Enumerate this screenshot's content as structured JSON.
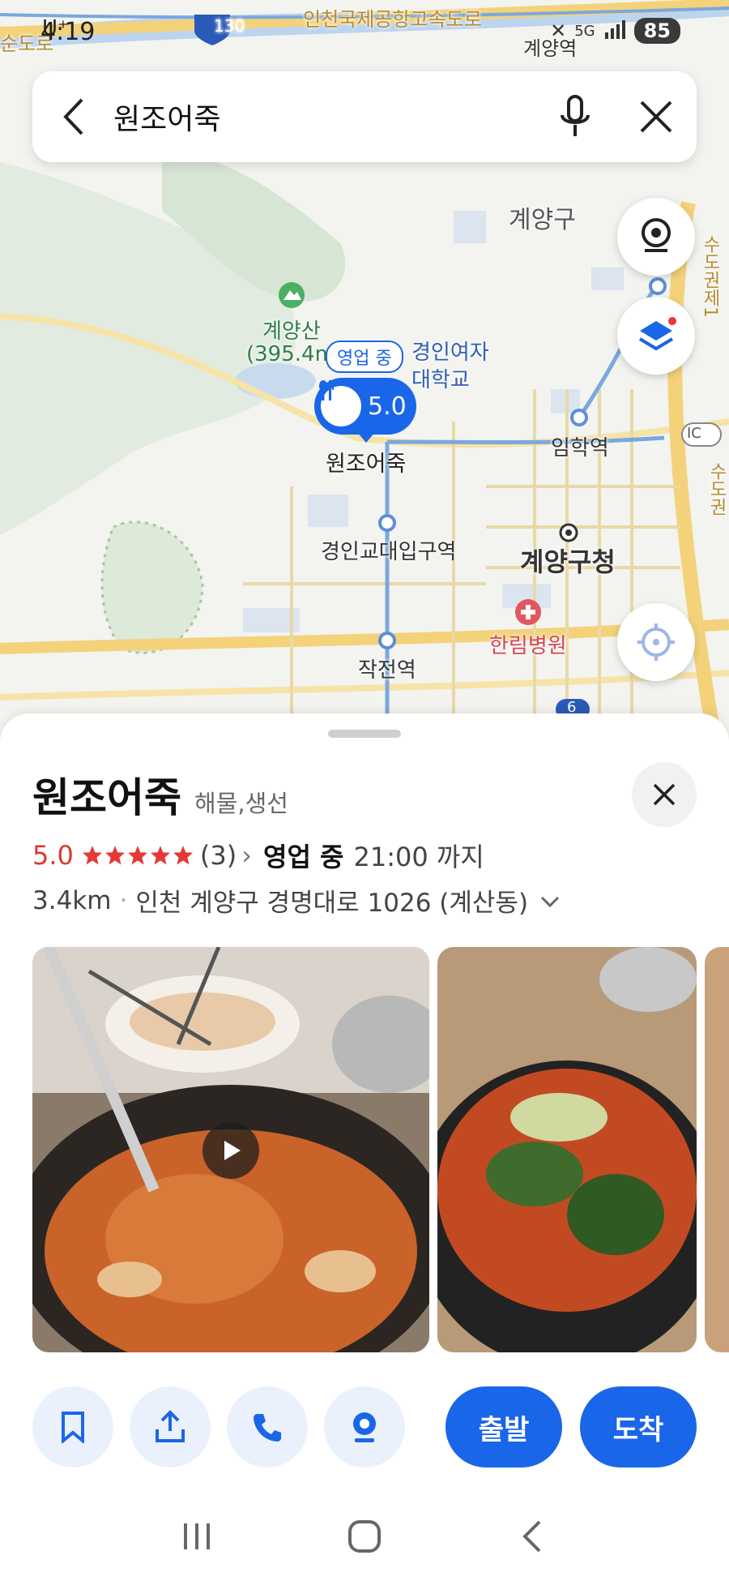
{
  "status_bar": {
    "time": "4:19",
    "carrier": "U⁺",
    "battery": "85",
    "network": "5G"
  },
  "search": {
    "query": "원조어죽"
  },
  "map": {
    "labels": {
      "gyeyang_gu": "계양구",
      "gyeyangsan": "계양산",
      "gyeyangsan_elev": "(395.4m",
      "university_1": "경인여자",
      "university_2": "대학교",
      "imhak_station": "임학역",
      "gyeongin_station": "경인교대입구역",
      "gyeyang_office": "계양구청",
      "hallym": "한림병원",
      "jakjeon_station": "작전역",
      "road_top": "인천국제공항고속도로",
      "road_left": "순도로",
      "road_right_1": "수도권제1",
      "road_right_2": "수도권",
      "highway_no": "130",
      "route_no": "6",
      "ic": "IC",
      "top_station": "계양역"
    },
    "marker": {
      "open_chip": "영업 중",
      "rating": "5.0",
      "name": "원조어죽"
    }
  },
  "place": {
    "name": "원조어죽",
    "category": "해물,생선",
    "rating": "5.0",
    "review_count": "(3)",
    "open_status": "영업 중",
    "open_until": "21:00 까지",
    "distance": "3.4km",
    "address": "인천 계양구 경명대로 1026 (계산동)"
  },
  "actions": {
    "depart": "출발",
    "arrive": "도착"
  },
  "colors": {
    "accent": "#1a66e8",
    "rating": "#d93a2e"
  }
}
